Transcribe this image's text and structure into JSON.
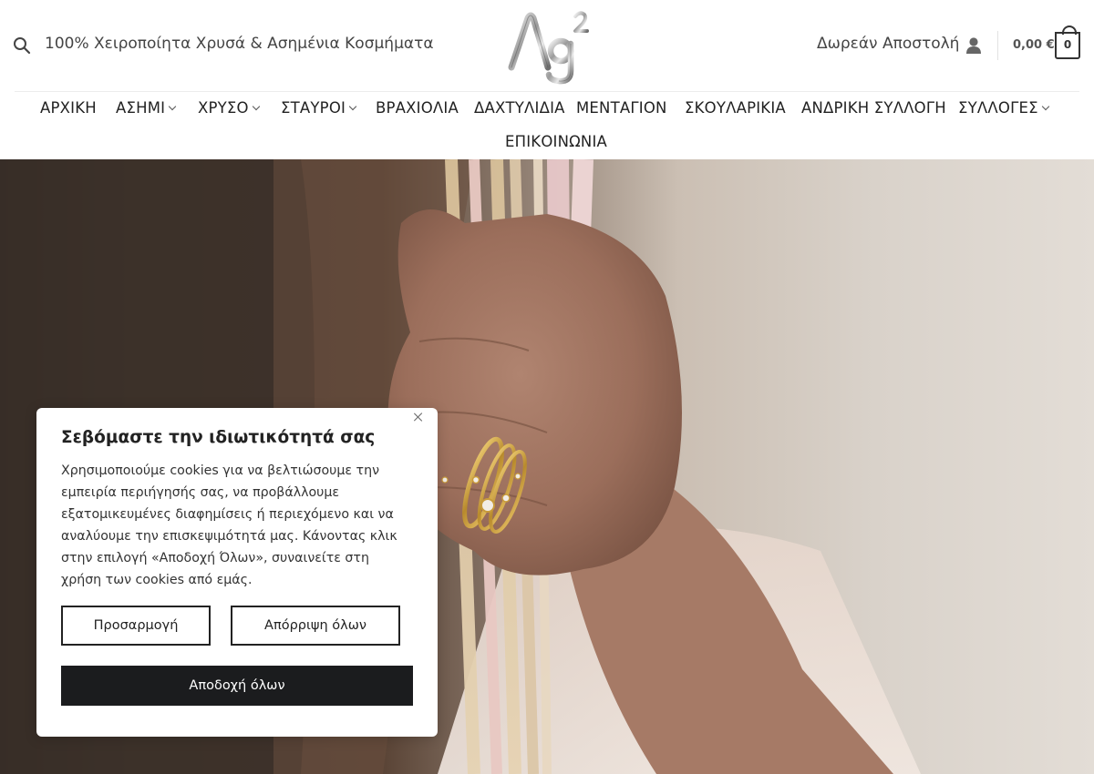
{
  "header": {
    "tagline": "100% Χειροποίητα Χρυσά & Ασημένια Κοσμήματα",
    "logo_text": "Ag²",
    "free_shipping": "Δωρεάν Αποστολή",
    "cart_total": "0,00 €",
    "cart_count": "0"
  },
  "nav": {
    "items": [
      {
        "label": "ΑΡΧΙΚΗ",
        "has_submenu": false
      },
      {
        "label": "ΑΣΗΜΙ",
        "has_submenu": true
      },
      {
        "label": "ΧΡΥΣΟ",
        "has_submenu": true
      },
      {
        "label": "ΣΤΑΥΡΟΙ",
        "has_submenu": true
      },
      {
        "label": "ΒΡΑΧΙΟΛΙΑ",
        "has_submenu": false
      },
      {
        "label": "ΔΑΧΤΥΛΙΔΙΑ",
        "has_submenu": false
      },
      {
        "label": "ΜΕΝΤΑΓΙΟΝ",
        "has_submenu": false
      },
      {
        "label": "ΣΚΟΥΛΑΡΙΚΙΑ",
        "has_submenu": false
      },
      {
        "label": "ΑΝΔΡΙΚΗ ΣΥΛΛΟΓΗ",
        "has_submenu": false
      },
      {
        "label": "ΣΥΛΛΟΓΕΣ",
        "has_submenu": true
      },
      {
        "label": "ΕΠΙΚΟΙΝΩΝΙΑ",
        "has_submenu": false
      }
    ]
  },
  "cookie": {
    "title": "Σεβόμαστε την ιδιωτικότητά σας",
    "text": "Χρησιμοποιούμε cookies για να βελτιώσουμε την εμπειρία περιήγησής σας, να προβάλλουμε εξατομικευμένες διαφημίσεις ή περιεχόμενο και να αναλύουμε την επισκεψιμότητά μας. Κάνοντας κλικ στην επιλογή «Αποδοχή Όλων», συναινείτε στη χρήση των cookies από εμάς.",
    "customize_label": "Προσαρμογή",
    "reject_label": "Απόρριψη όλων",
    "accept_label": "Αποδοχή όλων"
  },
  "icons": {
    "search": "search-icon",
    "user": "user-icon",
    "cart": "shopping-bag-icon",
    "close": "close-icon",
    "chevron": "chevron-down-icon"
  }
}
